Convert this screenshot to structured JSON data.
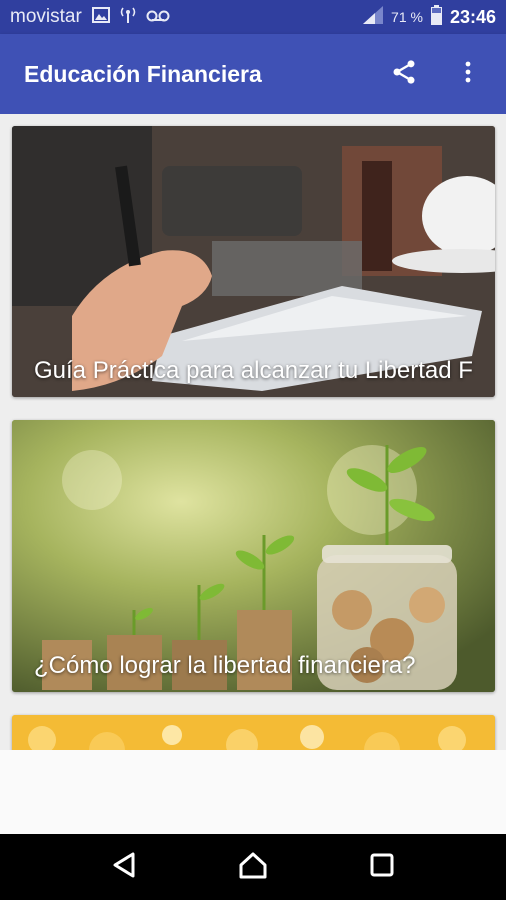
{
  "status_bar": {
    "carrier": "movistar",
    "battery_percent": "71 %",
    "time": "23:46",
    "icons": [
      "image-icon",
      "antenna-icon",
      "voicemail-icon",
      "signal-icon",
      "battery-icon"
    ]
  },
  "app_bar": {
    "title": "Educación Financiera",
    "actions": [
      "share-icon",
      "more-vert-icon"
    ]
  },
  "cards": [
    {
      "title": "Guía Práctica para alcanzar tu Libertad F",
      "image": "person-writing-in-notebook"
    },
    {
      "title": "¿Cómo lograr la libertad financiera?",
      "image": "plants-growing-from-coins"
    },
    {
      "title": "",
      "image": "golden-bokeh"
    }
  ],
  "nav_bar": {
    "buttons": [
      "back-icon",
      "home-icon",
      "recents-icon"
    ]
  },
  "colors": {
    "primary": "#3f51b5",
    "primary_dark": "#303f9f",
    "background": "#eeeeee"
  }
}
